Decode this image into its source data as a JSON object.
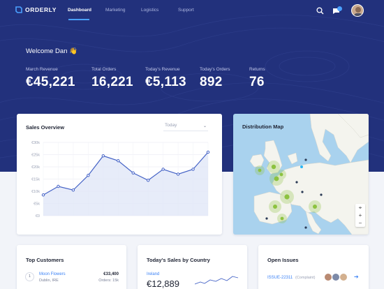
{
  "app": {
    "name": "ORDERLY"
  },
  "nav": {
    "items": [
      {
        "label": "Dashboard",
        "active": true
      },
      {
        "label": "Marketing",
        "active": false
      },
      {
        "label": "Logistics",
        "active": false
      },
      {
        "label": "Support",
        "active": false
      }
    ]
  },
  "header": {
    "welcome": "Welcome Dan 👋"
  },
  "stats": [
    {
      "label": "March Revenue",
      "value": "€45,221"
    },
    {
      "label": "Total Orders",
      "value": "16,221"
    },
    {
      "label": "Today's Revenue",
      "value": "€5,113"
    },
    {
      "label": "Today's Orders",
      "value": "892"
    },
    {
      "label": "Returns",
      "value": "76"
    }
  ],
  "sales_overview": {
    "title": "Sales Overview",
    "period_select": "Today",
    "chart_data": {
      "type": "area",
      "title": "Sales Overview",
      "yticks": [
        "€30k",
        "€25k",
        "€20k",
        "€15k",
        "€10k",
        "€5k",
        "€0"
      ],
      "ylim": [
        0,
        30000
      ],
      "values": [
        8500,
        12000,
        10500,
        16500,
        24500,
        22500,
        17500,
        14500,
        19000,
        17000,
        19000,
        26000
      ],
      "grid": true,
      "line_color": "#4563c6",
      "fill_color": "#dfe5f7"
    }
  },
  "distribution_map": {
    "title": "Distribution Map"
  },
  "top_customers": {
    "title": "Top Customers",
    "rows": [
      {
        "rank": "1",
        "name": "Moon Flowers",
        "location": "Dublin, IRE",
        "amount": "€33,400",
        "orders": "Orders: 15k"
      }
    ]
  },
  "sales_by_country": {
    "title": "Today's Sales by Country",
    "rows": [
      {
        "country": "Ireland",
        "value": "€12,889"
      }
    ]
  },
  "open_issues": {
    "title": "Open Issues",
    "rows": [
      {
        "id": "ISSUE-22311",
        "tag": "(Complaint)"
      }
    ]
  },
  "colors": {
    "hero_bg": "#22317c",
    "accent": "#4aa0ff",
    "link": "#3b82f6",
    "map_water": "#a9d2ee",
    "map_land": "#f4f4ee",
    "map_marker": "#8cc23f"
  },
  "icons": [
    "logo-icon",
    "search-icon",
    "notifications-icon",
    "avatar",
    "zoom-in-icon",
    "zoom-out-icon",
    "locate-icon",
    "arrow-right-icon"
  ]
}
